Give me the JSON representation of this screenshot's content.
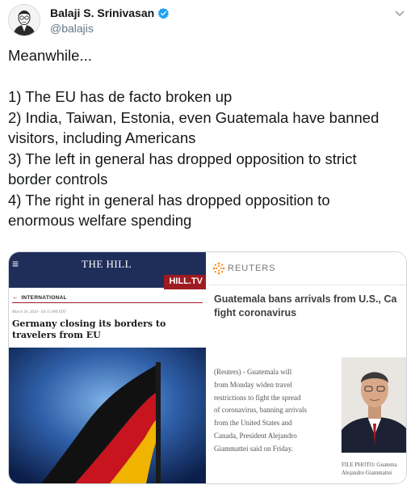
{
  "author": {
    "name": "Balaji S. Srinivasan",
    "handle": "@balajis",
    "avatar_icon": "sketch-portrait-avatar",
    "verified_icon": "verified-badge-icon",
    "verified_color": "#1da1f2"
  },
  "menu_icon": "chevron-down-icon",
  "tweet": {
    "lines": [
      "Meanwhile...",
      "",
      "1) The EU has de facto broken up",
      "2) India, Taiwan, Estonia, even Guatemala have banned",
      "visitors, including Americans",
      "3) The left in general has dropped opposition to strict",
      "border controls",
      "4) The right in general has dropped opposition to",
      "enormous welfare spending"
    ]
  },
  "media": {
    "left": {
      "logo": "THE HILL",
      "menu_glyph": "≡",
      "tv_label": "HILL.TV",
      "section_label": "INTERNATIONAL",
      "dateline": "March 18, 2020 - 04:15 PM EDT",
      "headline": "Germany closing its borders to travelers from EU",
      "photo_icon": "german-flag-photo",
      "brand_color": "#1f2d5a",
      "accent_color": "#9e1b22"
    },
    "right": {
      "source": "REUTERS",
      "source_icon": "reuters-logo-icon",
      "headline_lines": [
        "Guatemala bans arrivals from U.S., Ca",
        "fight coronavirus"
      ],
      "body_lines": [
        "(Reuters) - Guatemala will",
        "from Monday widen travel",
        "restrictions to fight the spread",
        "of coronavirus, banning arrivals",
        "from the United States and",
        "Canada, President Alejandro",
        "Giammattei said on Friday."
      ],
      "photo_icon": "president-portrait-photo",
      "caption_lines": [
        "FILE PHOTO: Guatema",
        "Alejandro Giammattei"
      ]
    }
  }
}
